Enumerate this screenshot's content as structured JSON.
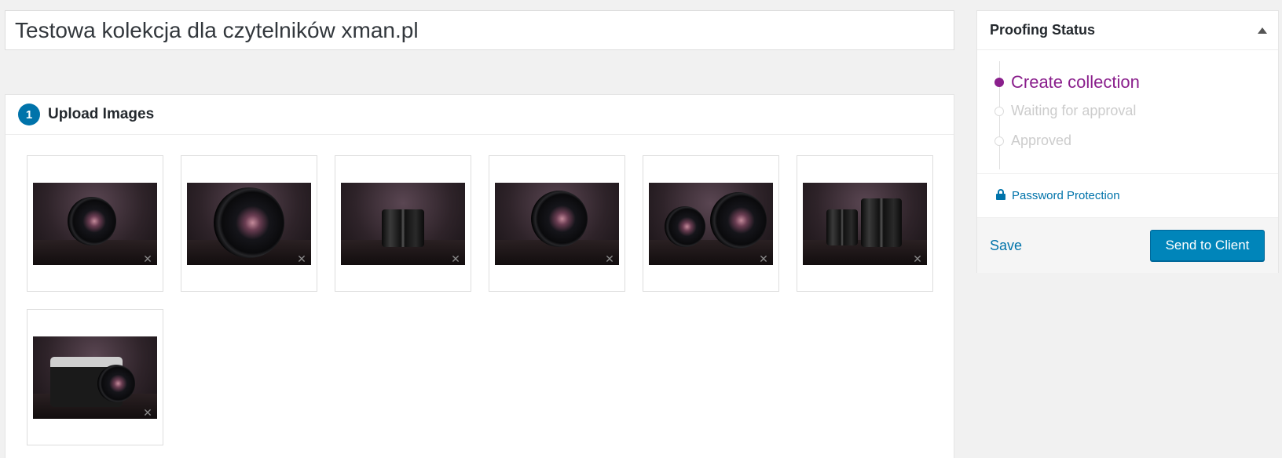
{
  "collection": {
    "title": "Testowa kolekcja dla czytelników xman.pl"
  },
  "upload": {
    "step_number": "1",
    "title": "Upload Images",
    "remove_glyph": "✕",
    "images": [
      {
        "subject": "lens-front"
      },
      {
        "subject": "lens-closeup"
      },
      {
        "subject": "lens-side"
      },
      {
        "subject": "lens-front"
      },
      {
        "subject": "two-lenses"
      },
      {
        "subject": "lens-and-camera"
      },
      {
        "subject": "camera"
      }
    ]
  },
  "proofing": {
    "title": "Proofing Status",
    "steps": [
      {
        "label": "Create collection",
        "active": true
      },
      {
        "label": "Waiting for approval",
        "active": false
      },
      {
        "label": "Approved",
        "active": false
      }
    ],
    "password_link": "Password Protection",
    "save_label": "Save",
    "send_label": "Send to Client"
  },
  "colors": {
    "accent": "#0085ba",
    "link": "#0073aa",
    "active_step": "#8a1f8c"
  }
}
